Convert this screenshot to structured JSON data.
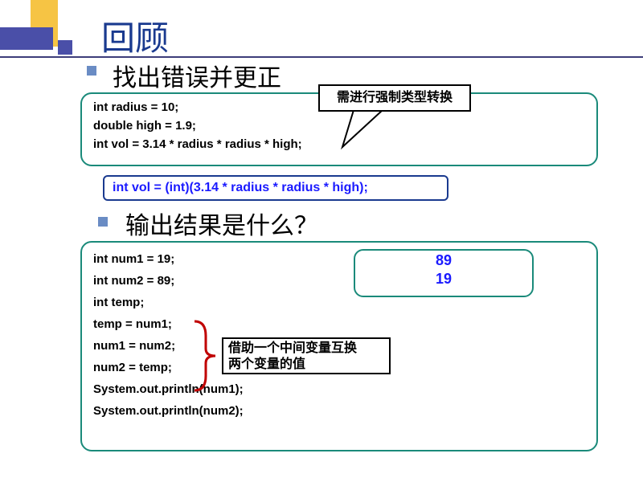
{
  "title": "回顾",
  "subtitle1": "找出错误并更正",
  "code1": {
    "line1": "int radius = 10;",
    "line2": "double  high = 1.9;",
    "line3": "int vol = 3.14 * radius * radius * high;"
  },
  "callout1": "需进行强制类型转换",
  "bluebox": "int vol = (int)(3.14 * radius * radius * high);",
  "subtitle2": "输出结果是什么？",
  "code2": {
    "line1": "int num1 = 19;",
    "line2": "int num2 = 89;",
    "line3": "int temp;",
    "line4": "temp = num1;",
    "line5": "num1 = num2;",
    "line6": "num2 = temp;",
    "line7": "System.out.println(num1);",
    "line8": "System.out.println(num2);"
  },
  "output": {
    "line1": "89",
    "line2": "19"
  },
  "callout2_line1": "借助一个中间变量互换",
  "callout2_line2": "两个变量的值"
}
